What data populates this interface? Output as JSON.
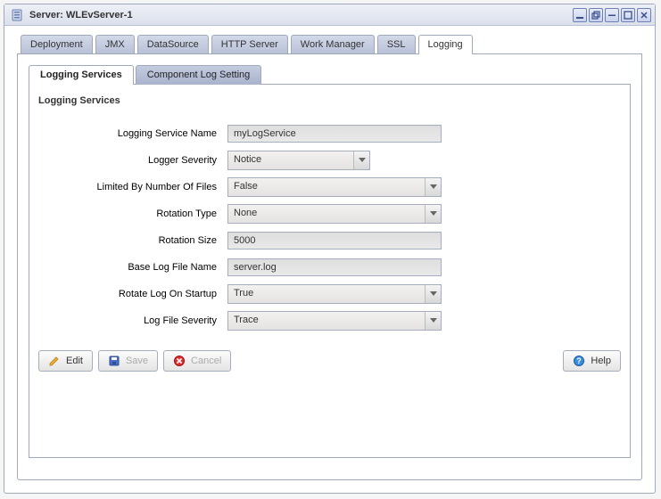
{
  "window": {
    "title": "Server: WLEvServer-1"
  },
  "tabs": {
    "main": [
      {
        "label": "Deployment",
        "active": false
      },
      {
        "label": "JMX",
        "active": false
      },
      {
        "label": "DataSource",
        "active": false
      },
      {
        "label": "HTTP Server",
        "active": false
      },
      {
        "label": "Work Manager",
        "active": false
      },
      {
        "label": "SSL",
        "active": false
      },
      {
        "label": "Logging",
        "active": true
      }
    ],
    "sub": [
      {
        "label": "Logging Services",
        "active": true
      },
      {
        "label": "Component Log Setting",
        "active": false
      }
    ]
  },
  "section": {
    "title": "Logging Services"
  },
  "fields": {
    "service_name": {
      "label": "Logging Service Name",
      "value": "myLogService",
      "type": "text"
    },
    "logger_severity": {
      "label": "Logger Severity",
      "value": "Notice",
      "type": "select",
      "width": "narrow"
    },
    "limited_files": {
      "label": "Limited By Number Of Files",
      "value": "False",
      "type": "select",
      "width": "wide"
    },
    "rotation_type": {
      "label": "Rotation Type",
      "value": "None",
      "type": "select",
      "width": "wide"
    },
    "rotation_size": {
      "label": "Rotation Size",
      "value": "5000",
      "type": "text"
    },
    "base_file": {
      "label": "Base Log File Name",
      "value": "server.log",
      "type": "text"
    },
    "rotate_startup": {
      "label": "Rotate Log On Startup",
      "value": "True",
      "type": "select",
      "width": "wide"
    },
    "file_severity": {
      "label": "Log File Severity",
      "value": "Trace",
      "type": "select",
      "width": "wide"
    }
  },
  "buttons": {
    "edit": {
      "label": "Edit",
      "icon": "pencil-icon",
      "enabled": true
    },
    "save": {
      "label": "Save",
      "icon": "disk-icon",
      "enabled": false
    },
    "cancel": {
      "label": "Cancel",
      "icon": "cancel-icon",
      "enabled": false
    },
    "help": {
      "label": "Help",
      "icon": "help-icon",
      "enabled": true
    }
  }
}
